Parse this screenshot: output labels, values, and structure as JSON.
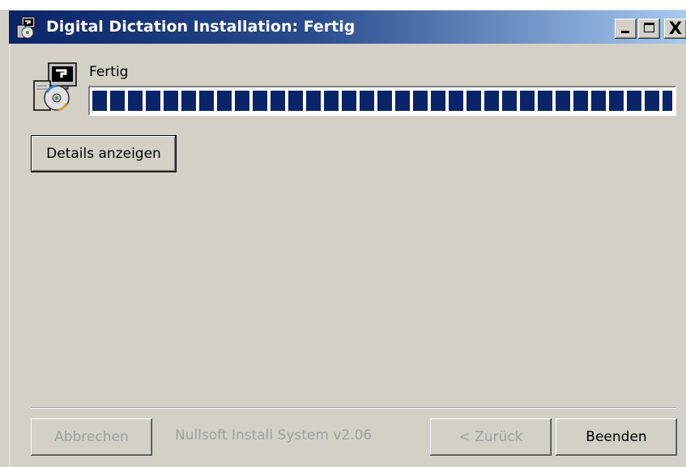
{
  "window": {
    "title": "Digital Dictation Installation: Fertig",
    "title_icon": "installer-icon",
    "controls": {
      "minimize_icon": "minimize-icon",
      "maximize_icon": "maximize-icon",
      "close_icon": "close-icon",
      "close_glyph": "X"
    }
  },
  "header": {
    "status_text": "Fertig",
    "app_icon": "installer-computer-cd-icon",
    "progress_fraction": 1.0
  },
  "buttons": {
    "details": "Details anzeigen",
    "cancel": "Abbrechen",
    "back": "< Zurück",
    "finish": "Beenden"
  },
  "footer": {
    "branding": "Nullsoft Install System v2.06"
  },
  "colors": {
    "title_gradient_start": "#0a246a",
    "title_gradient_end": "#a6caf0",
    "progress_block": "#0a246a",
    "dialog_bg": "#d4d0c8",
    "disabled_text": "#a0a0a0"
  }
}
